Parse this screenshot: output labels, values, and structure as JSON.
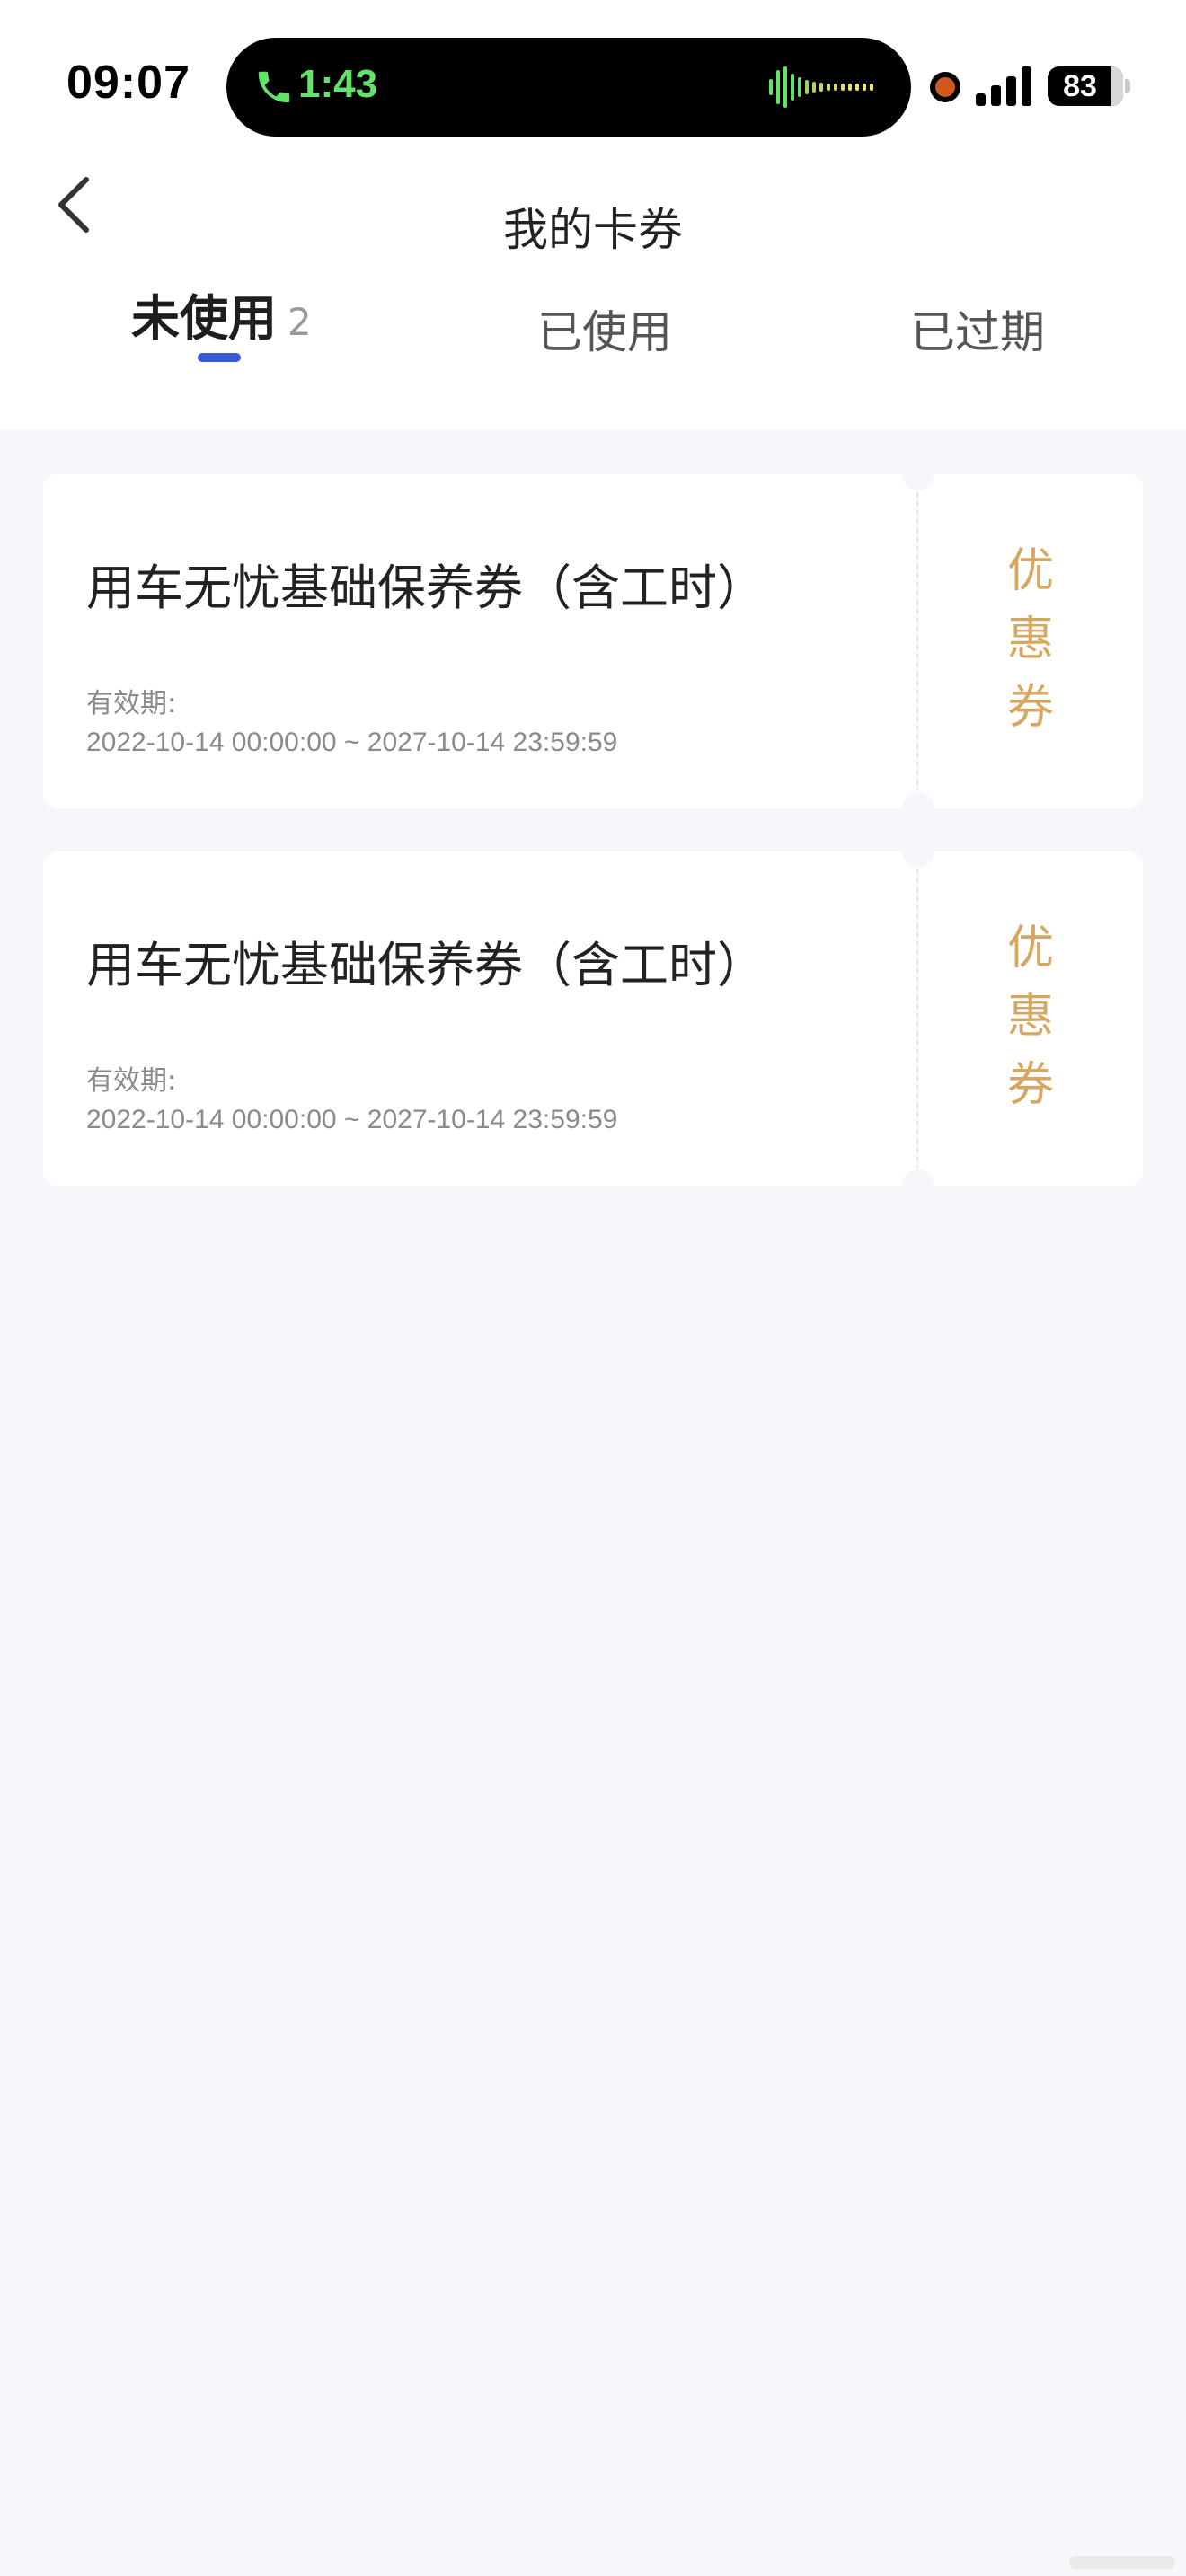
{
  "status_bar": {
    "time": "09:07",
    "call_timer": "1:43",
    "battery": "83",
    "battery_level_fraction": 0.83,
    "icons": [
      "phone-icon",
      "audio-waveform-icon",
      "recording-dot-icon",
      "cellular-signal-icon",
      "battery-icon"
    ]
  },
  "nav": {
    "back_icon": "chevron-left-icon",
    "title": "我的卡券"
  },
  "tabs": [
    {
      "label": "未使用",
      "count": "2",
      "active": true
    },
    {
      "label": "已使用",
      "active": false
    },
    {
      "label": "已过期",
      "active": false
    }
  ],
  "coupons": [
    {
      "title": "用车无忧基础保养券（含工时）",
      "validity_label": "有效期:",
      "validity": "2022-10-14 00:00:00 ~ 2027-10-14 23:59:59",
      "type": "优惠券"
    },
    {
      "title": "用车无忧基础保养券（含工时）",
      "validity_label": "有效期:",
      "validity": "2022-10-14 00:00:00 ~ 2027-10-14 23:59:59",
      "type": "优惠券"
    }
  ],
  "colors": {
    "accent": "#3a5bd9",
    "coupon_type": "#d7a660",
    "call_green": "#62e36a",
    "background": "#f6f7fb"
  }
}
